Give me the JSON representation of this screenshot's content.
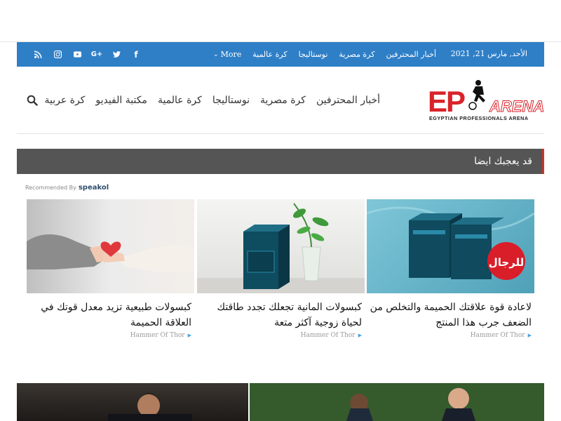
{
  "topbar": {
    "date": "الأحد, مارس 21, 2021",
    "nav": [
      "أخبار المحترفين",
      "كرة مصرية",
      "نوستاليجا",
      "كرة عالمية"
    ],
    "more_label": "More",
    "bg_color": "#2f7fc7"
  },
  "social": [
    "rss-icon",
    "instagram-icon",
    "youtube-icon",
    "google-plus-icon",
    "twitter-icon",
    "facebook-icon"
  ],
  "logo": {
    "main": "EP",
    "sub": "ARENA",
    "tagline": "EGYPTIAN PROFESSIONALS ARENA"
  },
  "mainnav": [
    "أخبار المحترفين",
    "كرة مصرية",
    "نوستاليجا",
    "كرة عالمية",
    "مكتبة الفيديو",
    "كرة عربية"
  ],
  "block": {
    "title": "قد يعجبك ايضا",
    "recommended_prefix": "Recommended By",
    "recommended_brand": "speakol"
  },
  "cards": [
    {
      "title": "لاعادة قوة علاقتك الحميمة والتخلص من الضعف جرب هذا المنتج",
      "source": "Hammer Of Thor",
      "badge": "للرجال"
    },
    {
      "title": "كبسولات المانية تجعلك تجدد طاقتك لحياة زوجية آكثر متعة",
      "source": "Hammer Of Thor"
    },
    {
      "title": "كبسولات طبيعية تزيد معدل قوتك في العلاقة الحميمة",
      "source": "Hammer Of Thor"
    }
  ]
}
